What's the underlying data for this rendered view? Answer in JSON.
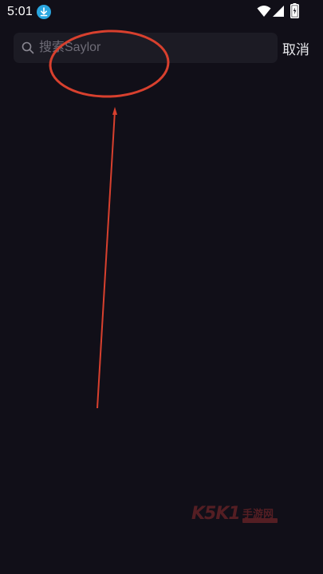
{
  "status_bar": {
    "time": "5:01",
    "icons": [
      "download-icon",
      "wifi-icon",
      "signal-icon",
      "battery-icon"
    ],
    "download_icon_color": "#2aa6e0"
  },
  "search": {
    "placeholder": "搜索Saylor",
    "value": "",
    "cancel_label": "取消"
  },
  "watermark": {
    "brand": "K5K1",
    "text": "手游网"
  },
  "colors": {
    "background": "#110f18",
    "search_box": "#1c1b24",
    "annotation": "#d8402e"
  }
}
